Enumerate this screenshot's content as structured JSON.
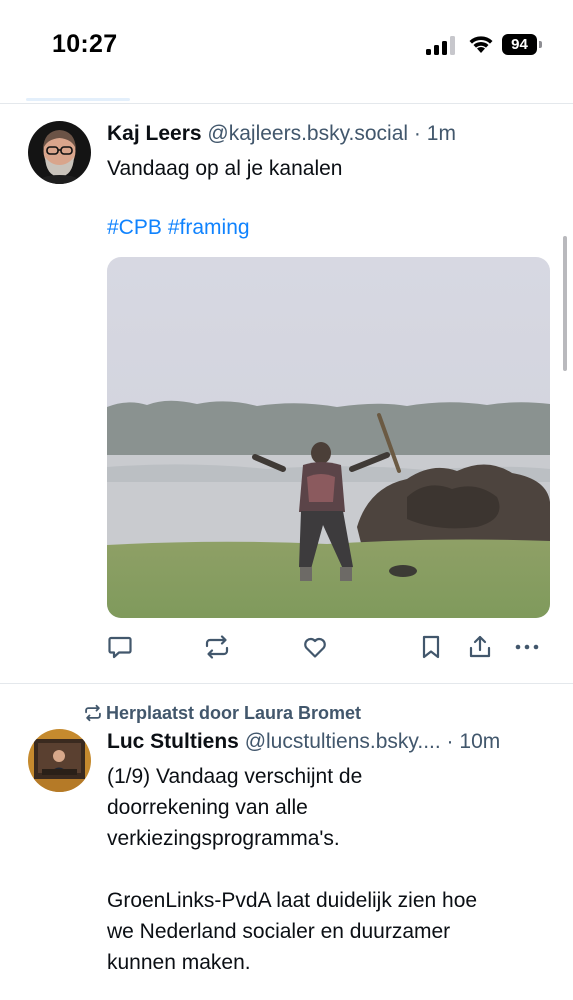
{
  "status_bar": {
    "time": "10:27",
    "battery_level": "94",
    "signal_bars": 3
  },
  "feed": {
    "posts": [
      {
        "author_name": "Kaj Leers",
        "author_handle": "@kajleers.bsky.social",
        "time_separator": "·",
        "time_ago": "1m",
        "text": "Vandaag op al je kanalen",
        "hashtags": [
          "#CPB",
          "#framing"
        ],
        "has_media": true,
        "actions": [
          "reply-icon",
          "repost-icon",
          "like-icon",
          "bookmark-icon",
          "share-icon",
          "more-icon"
        ]
      },
      {
        "repost_label": "Herplaatst door Laura Bromet",
        "author_name": "Luc Stultiens",
        "author_handle": "@lucstultiens.bsky....",
        "time_separator": "·",
        "time_ago": "10m",
        "text_lines": [
          "(1/9) Vandaag verschijnt de",
          "doorrekening van alle",
          "verkiezingsprogramma's.",
          "",
          "GroenLinks-PvdA laat duidelijk zien hoe",
          "we Nederland socialer en duurzamer",
          "kunnen maken."
        ]
      }
    ]
  },
  "colors": {
    "link": "#1083fe",
    "handle": "#42576c",
    "icon": "#42576c",
    "divider": "#e4e8ec"
  }
}
